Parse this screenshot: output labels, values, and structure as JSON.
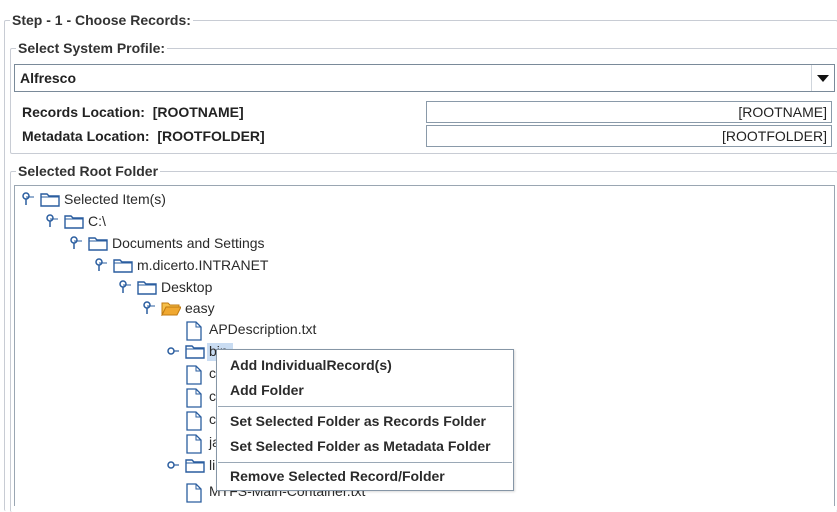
{
  "step_title": "Step - 1 - Choose Records:",
  "system_profile": {
    "legend": "Select System Profile:",
    "selected": "Alfresco"
  },
  "locations": {
    "records_label": "Records Location:",
    "records_value": "[ROOTNAME]",
    "records_field": "[ROOTNAME]",
    "metadata_label": "Metadata Location:",
    "metadata_value": "[ROOTFOLDER]",
    "metadata_field": "[ROOTFOLDER]"
  },
  "root_folder": {
    "legend": "Selected Root Folder",
    "nodes": [
      "Selected Item(s)",
      "C:\\",
      "Documents and Settings",
      "m.dicerto.INTRANET",
      "Desktop",
      "easy",
      "APDescription.txt",
      "bin",
      "c",
      "c",
      "c",
      "ja",
      "li",
      "MTFS-Main-Container.txt"
    ]
  },
  "context_menu": {
    "add_individual": "Add IndividualRecord(s)",
    "add_folder": "Add Folder",
    "set_records": "Set Selected Folder as Records Folder",
    "set_metadata": "Set Selected Folder as Metadata Folder",
    "remove": "Remove Selected Record/Folder"
  },
  "icons": {
    "expand_handle": "tree-expand-key-icon",
    "folder": "folder-icon",
    "open_folder": "folder-open-icon",
    "file": "file-icon",
    "dropdown": "chevron-down-icon"
  },
  "colors": {
    "folder_blue": "#2a5d9f",
    "folder_open": "#f0a830",
    "selection": "#c9dcf2",
    "border": "#c8ccd4"
  }
}
